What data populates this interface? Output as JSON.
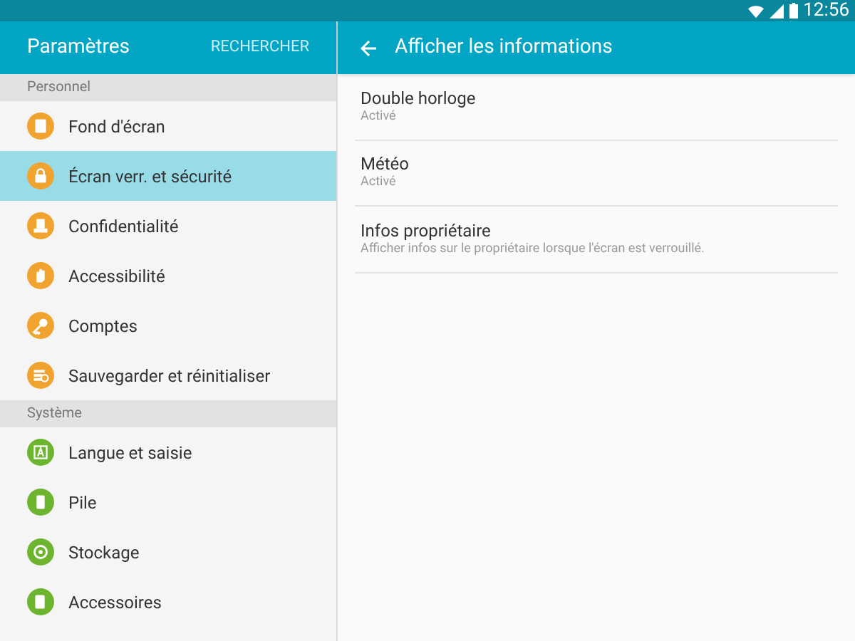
{
  "status_bar": {
    "time": "12:56"
  },
  "sidebar": {
    "title": "Paramètres",
    "search_button": "RECHERCHER",
    "sections": [
      {
        "title": "Personnel",
        "items": [
          {
            "label": "Fond d'écran",
            "color": "#f0a32e",
            "selected": false
          },
          {
            "label": "Écran verr. et sécurité",
            "color": "#f0a32e",
            "selected": true
          },
          {
            "label": "Confidentialité",
            "color": "#f0a32e",
            "selected": false
          },
          {
            "label": "Accessibilité",
            "color": "#f0a32e",
            "selected": false
          },
          {
            "label": "Comptes",
            "color": "#f0a32e",
            "selected": false
          },
          {
            "label": "Sauvegarder et réinitialiser",
            "color": "#f0a32e",
            "selected": false
          }
        ]
      },
      {
        "title": "Système",
        "items": [
          {
            "label": "Langue et saisie",
            "color": "#6db52f",
            "selected": false
          },
          {
            "label": "Pile",
            "color": "#6db52f",
            "selected": false
          },
          {
            "label": "Stockage",
            "color": "#6db52f",
            "selected": false
          },
          {
            "label": "Accessoires",
            "color": "#6db52f",
            "selected": false
          }
        ]
      }
    ]
  },
  "detail": {
    "title": "Afficher les informations",
    "rows": [
      {
        "title": "Double horloge",
        "summary": "Activé"
      },
      {
        "title": "Météo",
        "summary": "Activé"
      },
      {
        "title": "Infos propriétaire",
        "summary": "Afficher infos sur le propriétaire lorsque l'écran est verrouillé."
      }
    ]
  }
}
